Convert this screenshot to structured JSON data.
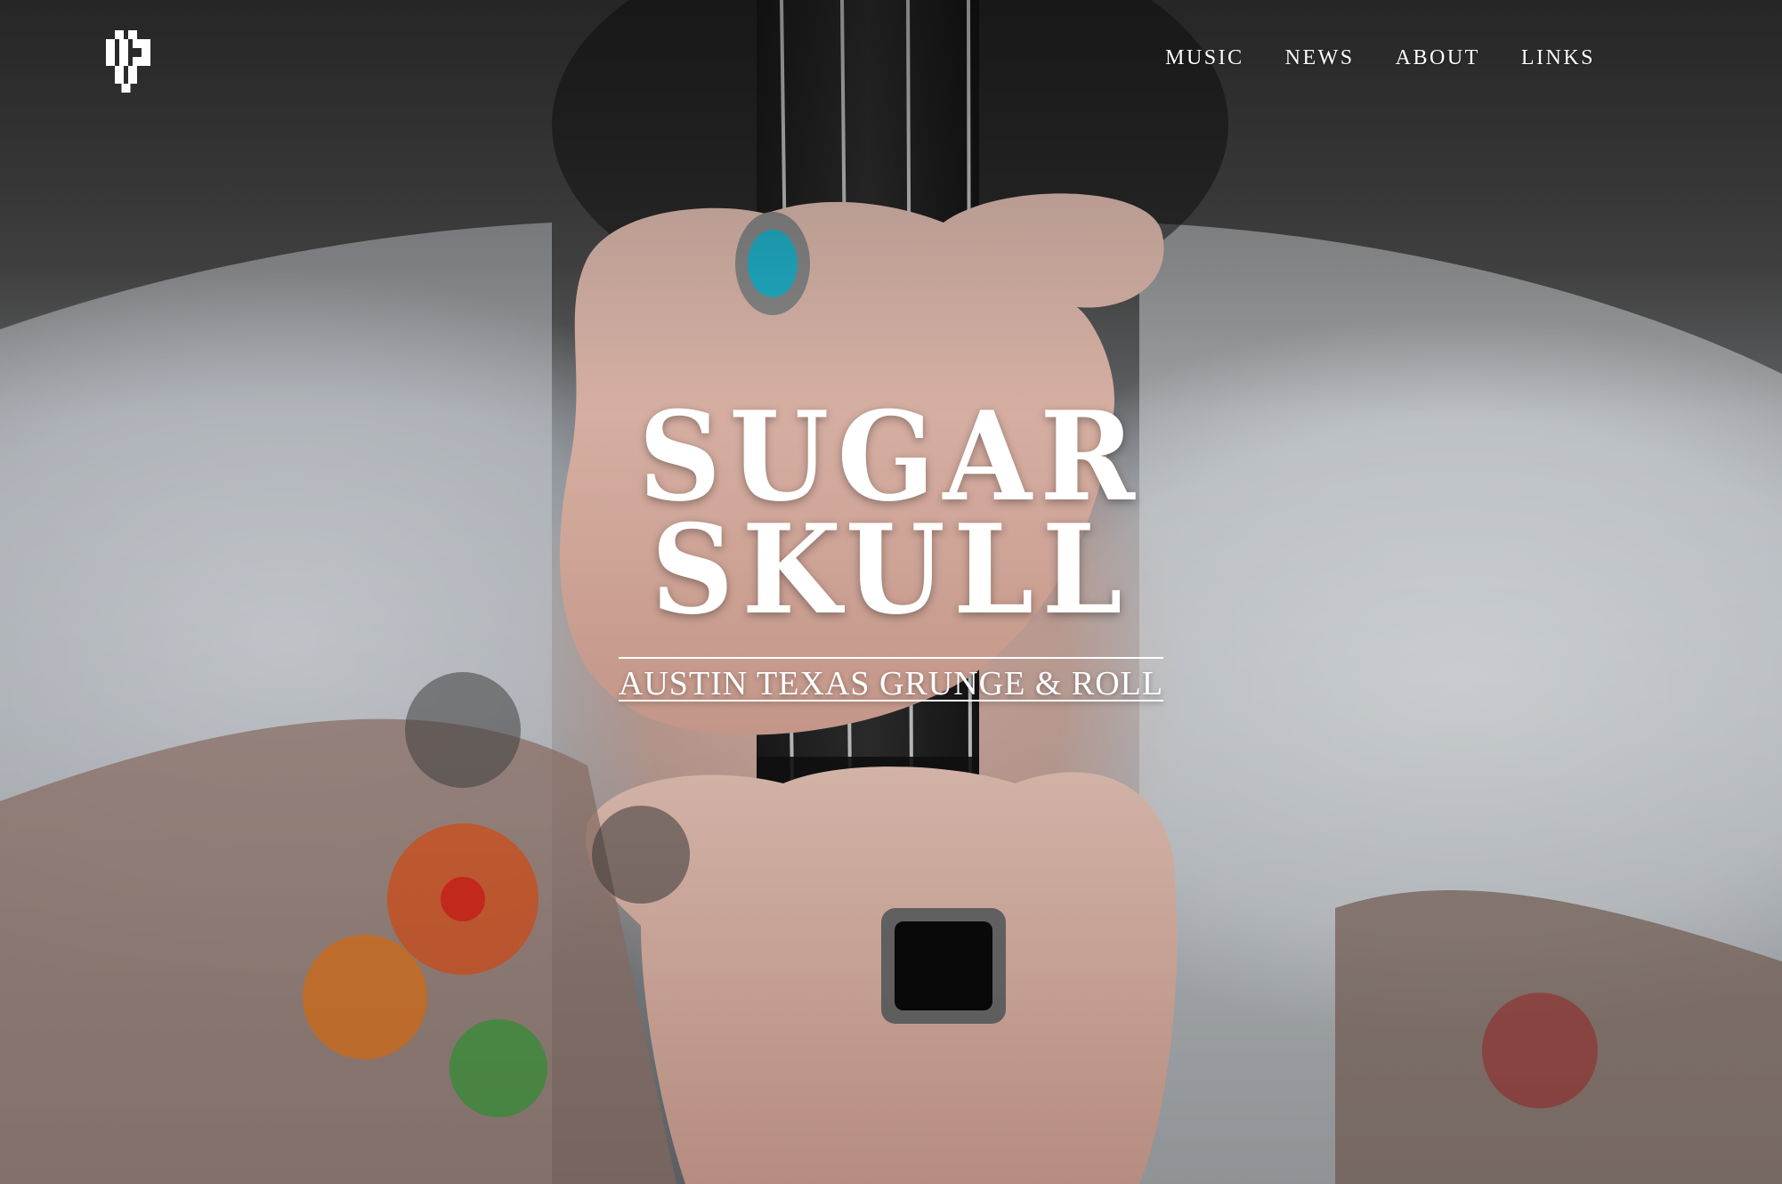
{
  "site": {
    "band_name_line1": "SUGAR",
    "band_name_line2": "SKULL",
    "tagline": "AUSTIN TEXAS GRUNGE & ROLL"
  },
  "nav": {
    "items": [
      {
        "label": "MUSIC"
      },
      {
        "label": "NEWS"
      },
      {
        "label": "ABOUT"
      },
      {
        "label": "LINKS"
      }
    ]
  },
  "logo": {
    "icon": "pixel-skull-icon"
  },
  "colors": {
    "text": "#ffffff"
  }
}
